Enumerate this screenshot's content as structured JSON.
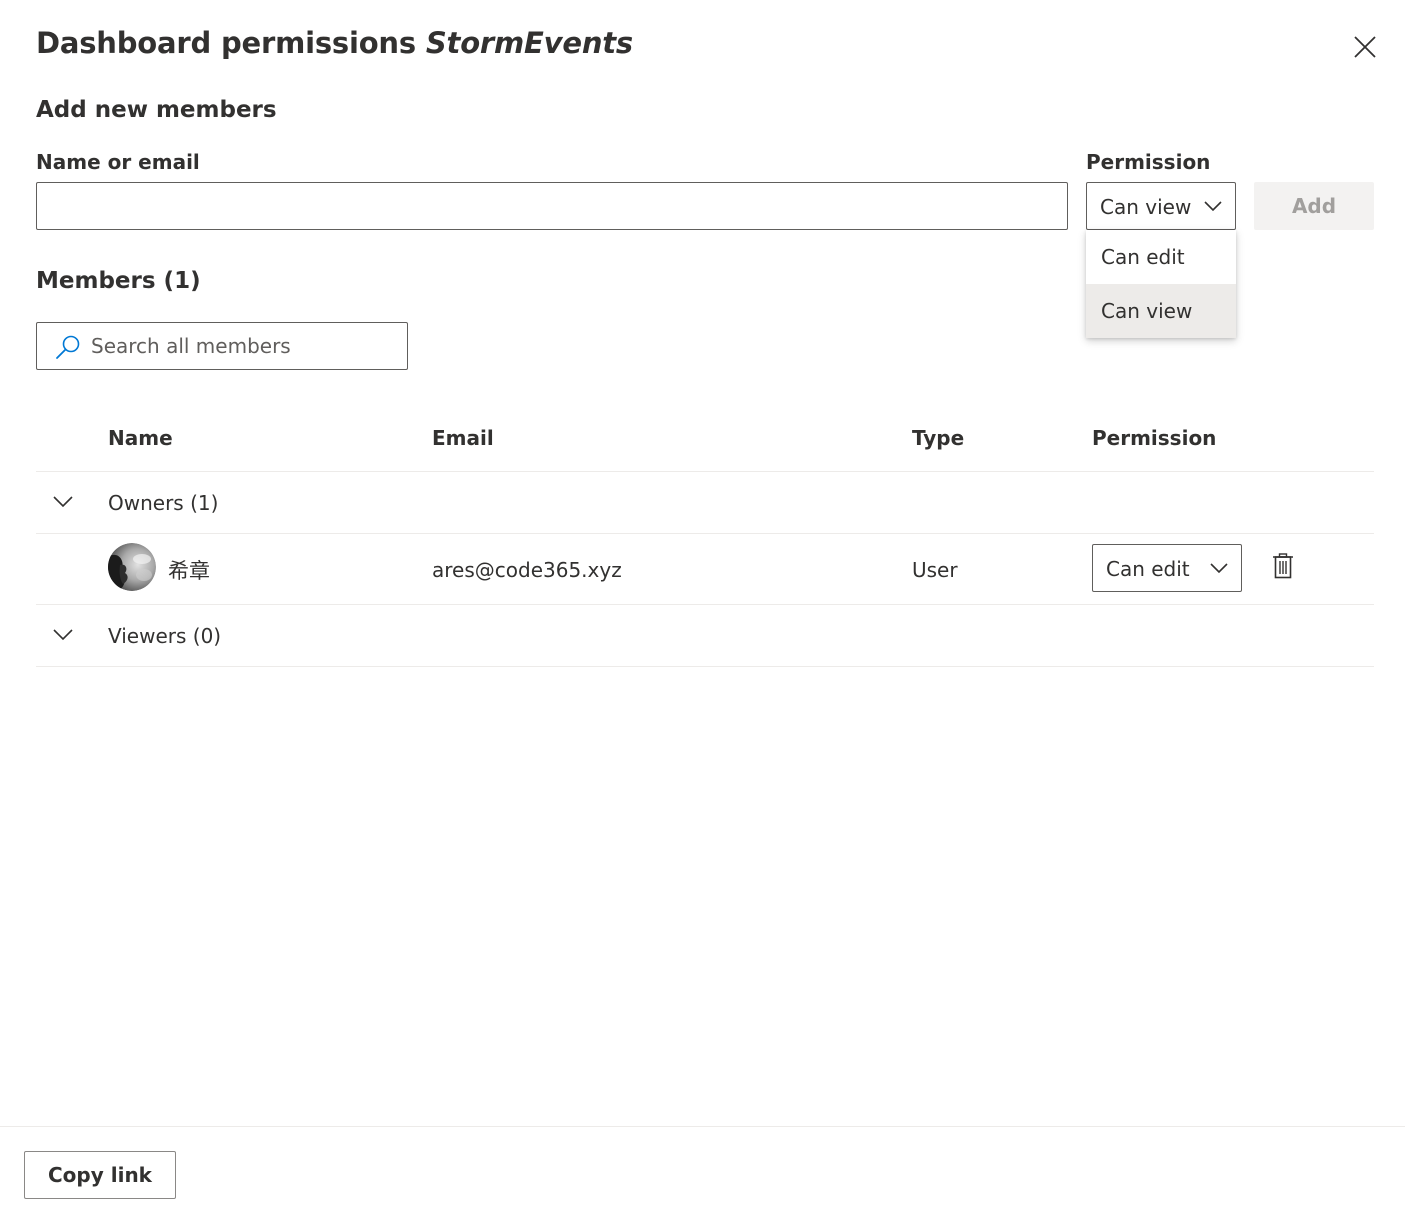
{
  "dialog": {
    "title_prefix": "Dashboard permissions",
    "dashboard_name": "StormEvents"
  },
  "add_members": {
    "heading": "Add new members",
    "name_label": "Name or email",
    "name_value": "",
    "permission_label": "Permission",
    "permission_selected": "Can view",
    "add_label": "Add",
    "options": [
      "Can edit",
      "Can view"
    ]
  },
  "members": {
    "heading": "Members (1)",
    "search_placeholder": "Search all members",
    "columns": {
      "name": "Name",
      "email": "Email",
      "type": "Type",
      "permission": "Permission"
    },
    "groups": {
      "owners": "Owners (1)",
      "viewers": "Viewers (0)"
    },
    "owner_rows": [
      {
        "name": "希章",
        "email": "ares@code365.xyz",
        "type": "User",
        "permission": "Can edit"
      }
    ]
  },
  "footer": {
    "copy_link_label": "Copy link"
  },
  "icons": {
    "close": "close-icon",
    "chevron": "chevron-down-icon",
    "search": "search-icon",
    "delete": "trash-icon"
  },
  "colors": {
    "text": "#323130",
    "border": "#605e5c",
    "divider": "#edebe9",
    "disabled_bg": "#f3f2f1",
    "disabled_text": "#a19f9d",
    "search_icon": "#0078d4",
    "selected_item": "#edebe9"
  }
}
